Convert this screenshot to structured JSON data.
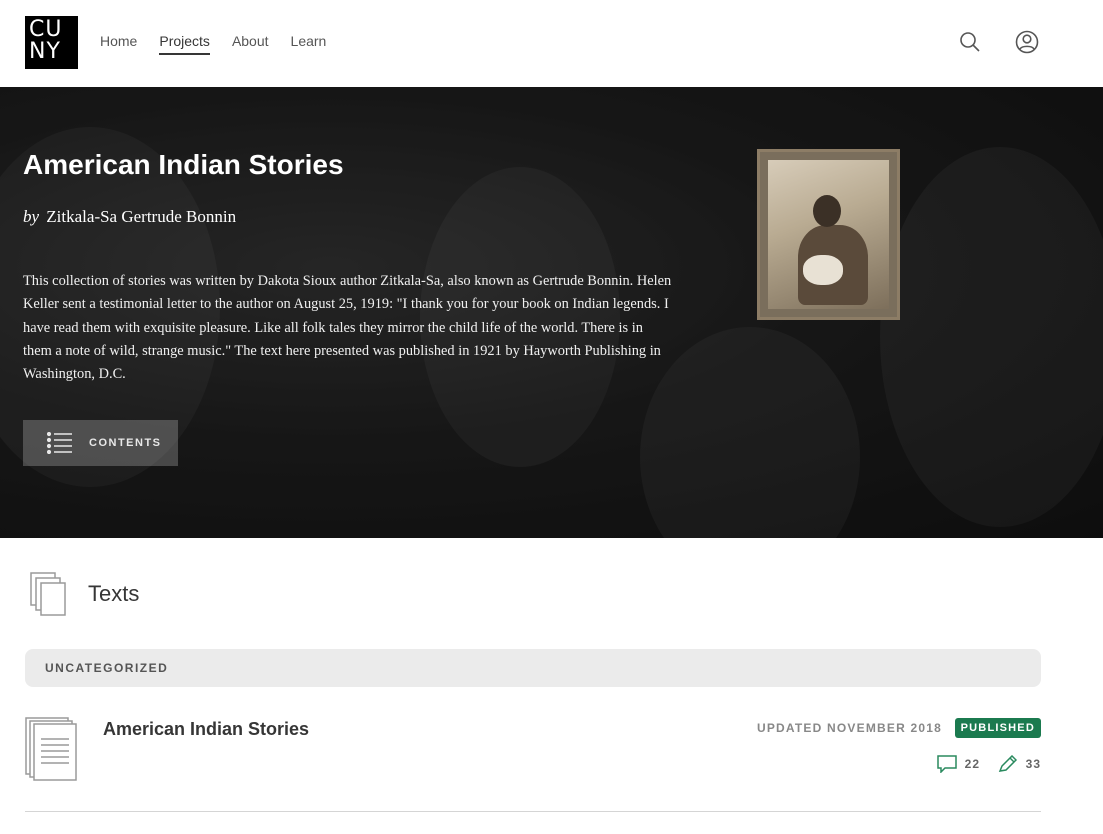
{
  "header": {
    "logo": {
      "line1": "CU",
      "line2": "NY"
    },
    "nav": [
      {
        "label": "Home",
        "active": false
      },
      {
        "label": "Projects",
        "active": true
      },
      {
        "label": "About",
        "active": false
      },
      {
        "label": "Learn",
        "active": false
      }
    ],
    "icons": [
      "search-icon",
      "user-icon"
    ]
  },
  "hero": {
    "title": "American Indian Stories",
    "by": "by",
    "author": "Zitkala-Sa Gertrude Bonnin",
    "description": "This collection of stories was written by Dakota Sioux author Zitkala-Sa, also known as Gertrude Bonnin. Helen Keller sent a testimonial letter to the author on August 25, 1919: \"I thank you for your book on Indian legends. I have read them with exquisite pleasure. Like all folk tales they mirror the child life of the world. There is in them a note of wild, strange music.\" The text here presented was published in 1921 by Hayworth Publishing in Washington, D.C.",
    "contents_label": "CONTENTS"
  },
  "texts": {
    "heading": "Texts",
    "category": "UNCATEGORIZED",
    "items": [
      {
        "title": "American Indian Stories",
        "updated": "UPDATED NOVEMBER 2018",
        "status": "PUBLISHED",
        "comments": "22",
        "annotations": "33"
      }
    ]
  },
  "colors": {
    "published_badge": "#1b7a4f",
    "category_bar": "#ebebeb"
  }
}
